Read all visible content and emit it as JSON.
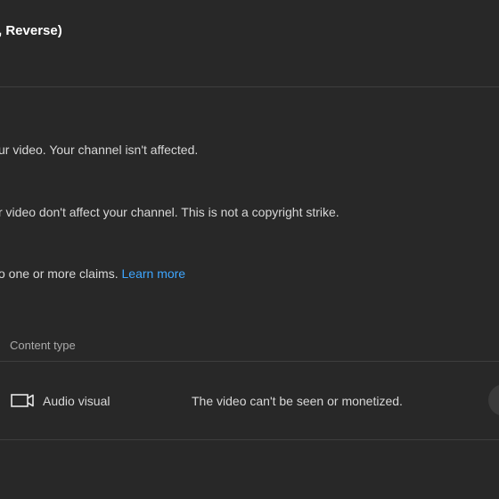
{
  "dialog": {
    "title": ", Reverse)"
  },
  "messages": {
    "channel_note": "ur video. Your channel isn't affected.",
    "strike_note": "r video don't affect your channel. This is not a copyright strike.",
    "claims_note": "o one or more claims.",
    "learn_more": "Learn more"
  },
  "table": {
    "header_content_type": "Content type",
    "rows": [
      {
        "icon": "video-camera-icon",
        "content_type": "Audio visual",
        "impact": "The video can't be seen or monetized."
      }
    ]
  }
}
